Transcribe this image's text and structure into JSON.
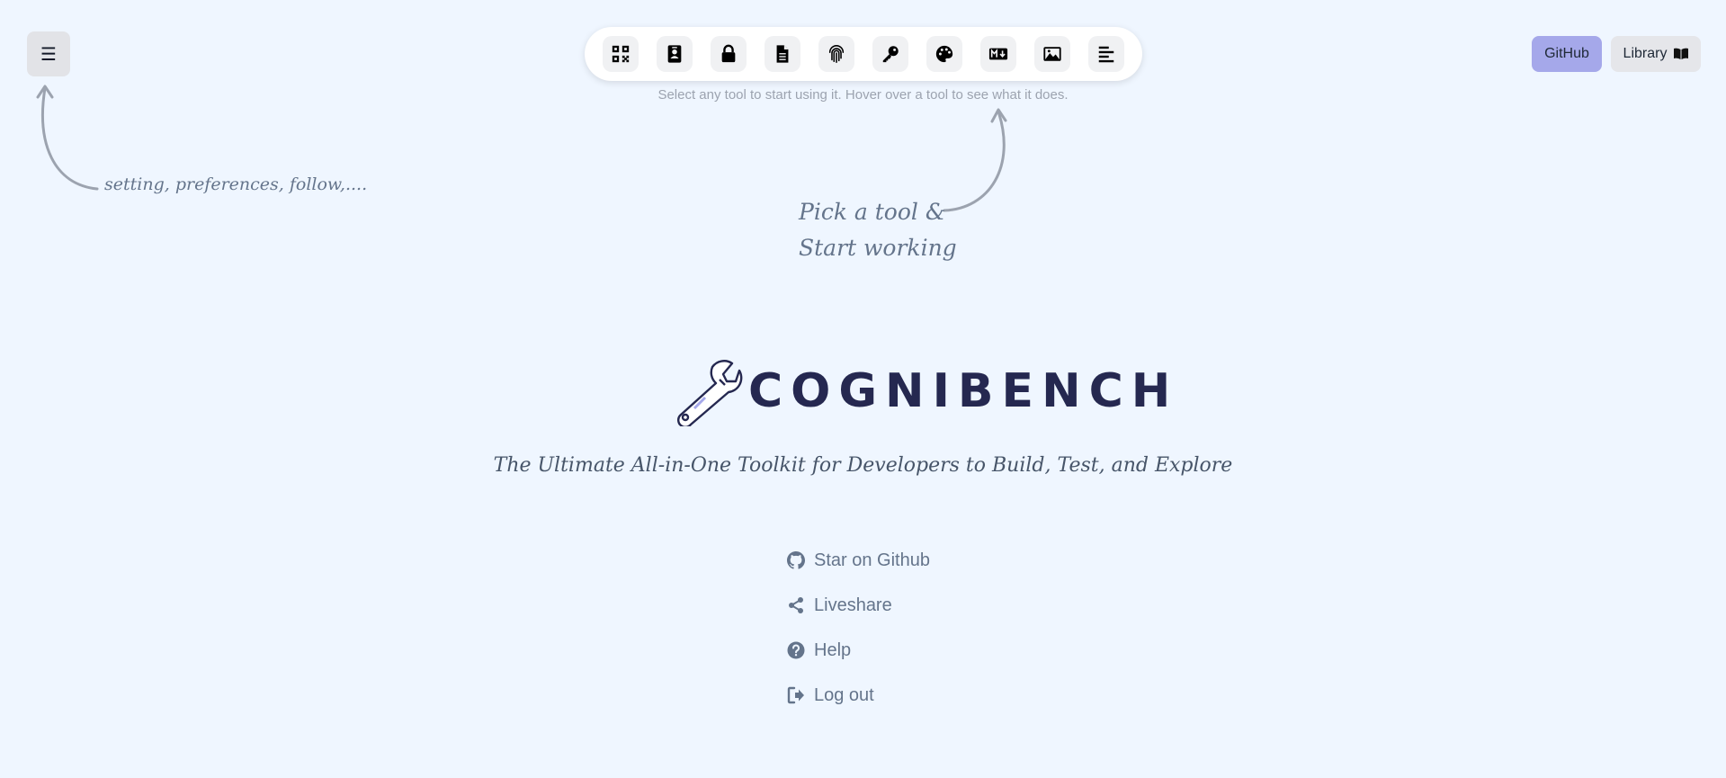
{
  "menu": {
    "icon": "hamburger-icon",
    "glyph": "☰"
  },
  "toolbar": {
    "tools": [
      {
        "icon": "qr-code-icon"
      },
      {
        "icon": "contact-card-icon"
      },
      {
        "icon": "lock-icon"
      },
      {
        "icon": "document-icon"
      },
      {
        "icon": "fingerprint-icon"
      },
      {
        "icon": "key-icon"
      },
      {
        "icon": "palette-icon"
      },
      {
        "icon": "markdown-icon"
      },
      {
        "icon": "image-icon"
      },
      {
        "icon": "align-left-icon"
      }
    ],
    "hint": "Select any tool to start using it. Hover over a tool to see what it does."
  },
  "header": {
    "github_label": "GitHub",
    "library_label": "Library",
    "library_icon": "book-icon"
  },
  "annotations": {
    "settings": "setting, preferences, follow,....",
    "pick_line1": "Pick a tool &",
    "pick_line2": "Start working"
  },
  "brand": {
    "name": "COGNIBENCH",
    "logo_icon": "wrench-icon",
    "tagline": "The Ultimate All-in-One Toolkit for Developers to Build, Test, and Explore"
  },
  "links": [
    {
      "label": "Star on Github",
      "icon": "github-icon"
    },
    {
      "label": "Liveshare",
      "icon": "share-icon"
    },
    {
      "label": "Help",
      "icon": "question-circle-icon"
    },
    {
      "label": "Log out",
      "icon": "logout-icon"
    }
  ],
  "colors": {
    "background": "#eff6ff",
    "github_button": "#a5a8ea",
    "brand_text": "#252850"
  }
}
